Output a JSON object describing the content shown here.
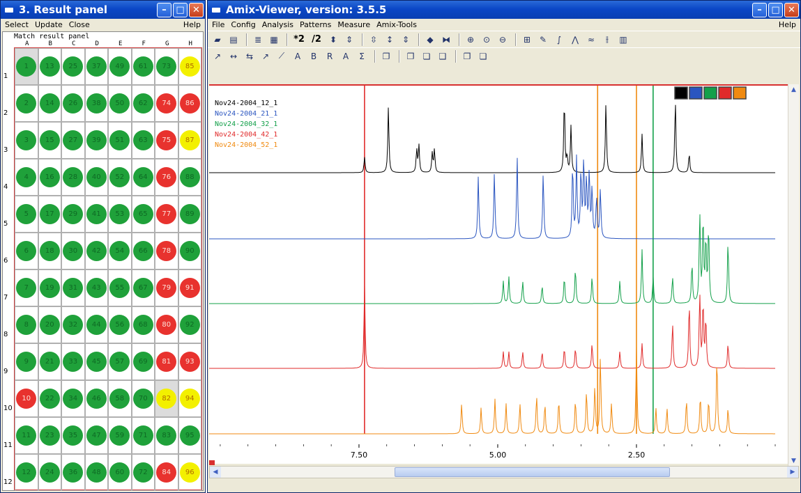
{
  "result_window": {
    "title": "3. Result panel",
    "menu": [
      "Select",
      "Update",
      "Close"
    ],
    "help": "Help",
    "caption": "Match result panel",
    "columns": [
      "A",
      "B",
      "C",
      "D",
      "E",
      "F",
      "G",
      "H"
    ],
    "rows": [
      "1",
      "2",
      "3",
      "4",
      "5",
      "6",
      "7",
      "8",
      "9",
      "10",
      "11",
      "12"
    ],
    "cells": [
      [
        {
          "n": "1",
          "c": "green",
          "sel": true
        },
        {
          "n": "13",
          "c": "green"
        },
        {
          "n": "25",
          "c": "green"
        },
        {
          "n": "37",
          "c": "green"
        },
        {
          "n": "49",
          "c": "green"
        },
        {
          "n": "61",
          "c": "green"
        },
        {
          "n": "73",
          "c": "green"
        },
        {
          "n": "85",
          "c": "yellow"
        }
      ],
      [
        {
          "n": "2",
          "c": "green"
        },
        {
          "n": "14",
          "c": "green"
        },
        {
          "n": "26",
          "c": "green"
        },
        {
          "n": "38",
          "c": "green"
        },
        {
          "n": "50",
          "c": "green"
        },
        {
          "n": "62",
          "c": "green"
        },
        {
          "n": "74",
          "c": "red"
        },
        {
          "n": "86",
          "c": "red"
        }
      ],
      [
        {
          "n": "3",
          "c": "green"
        },
        {
          "n": "15",
          "c": "green"
        },
        {
          "n": "27",
          "c": "green"
        },
        {
          "n": "39",
          "c": "green"
        },
        {
          "n": "51",
          "c": "green"
        },
        {
          "n": "63",
          "c": "green"
        },
        {
          "n": "75",
          "c": "red"
        },
        {
          "n": "87",
          "c": "yellow"
        }
      ],
      [
        {
          "n": "4",
          "c": "green"
        },
        {
          "n": "16",
          "c": "green"
        },
        {
          "n": "28",
          "c": "green"
        },
        {
          "n": "40",
          "c": "green"
        },
        {
          "n": "52",
          "c": "green"
        },
        {
          "n": "64",
          "c": "green"
        },
        {
          "n": "76",
          "c": "red"
        },
        {
          "n": "88",
          "c": "green"
        }
      ],
      [
        {
          "n": "5",
          "c": "green"
        },
        {
          "n": "17",
          "c": "green"
        },
        {
          "n": "29",
          "c": "green"
        },
        {
          "n": "41",
          "c": "green"
        },
        {
          "n": "53",
          "c": "green"
        },
        {
          "n": "65",
          "c": "green"
        },
        {
          "n": "77",
          "c": "red"
        },
        {
          "n": "89",
          "c": "green"
        }
      ],
      [
        {
          "n": "6",
          "c": "green"
        },
        {
          "n": "18",
          "c": "green"
        },
        {
          "n": "30",
          "c": "green"
        },
        {
          "n": "42",
          "c": "green"
        },
        {
          "n": "54",
          "c": "green"
        },
        {
          "n": "66",
          "c": "green"
        },
        {
          "n": "78",
          "c": "red"
        },
        {
          "n": "90",
          "c": "green"
        }
      ],
      [
        {
          "n": "7",
          "c": "green"
        },
        {
          "n": "19",
          "c": "green"
        },
        {
          "n": "31",
          "c": "green"
        },
        {
          "n": "43",
          "c": "green"
        },
        {
          "n": "55",
          "c": "green"
        },
        {
          "n": "67",
          "c": "green"
        },
        {
          "n": "79",
          "c": "red"
        },
        {
          "n": "91",
          "c": "red"
        }
      ],
      [
        {
          "n": "8",
          "c": "green"
        },
        {
          "n": "20",
          "c": "green"
        },
        {
          "n": "32",
          "c": "green"
        },
        {
          "n": "44",
          "c": "green"
        },
        {
          "n": "56",
          "c": "green"
        },
        {
          "n": "68",
          "c": "green"
        },
        {
          "n": "80",
          "c": "red"
        },
        {
          "n": "92",
          "c": "green"
        }
      ],
      [
        {
          "n": "9",
          "c": "green"
        },
        {
          "n": "21",
          "c": "green"
        },
        {
          "n": "33",
          "c": "green"
        },
        {
          "n": "45",
          "c": "green"
        },
        {
          "n": "57",
          "c": "green"
        },
        {
          "n": "69",
          "c": "green"
        },
        {
          "n": "81",
          "c": "red"
        },
        {
          "n": "93",
          "c": "red"
        }
      ],
      [
        {
          "n": "10",
          "c": "red"
        },
        {
          "n": "22",
          "c": "green"
        },
        {
          "n": "34",
          "c": "green"
        },
        {
          "n": "46",
          "c": "green"
        },
        {
          "n": "58",
          "c": "green"
        },
        {
          "n": "70",
          "c": "green"
        },
        {
          "n": "82",
          "c": "yellow",
          "sel": true
        },
        {
          "n": "94",
          "c": "yellow"
        }
      ],
      [
        {
          "n": "11",
          "c": "green"
        },
        {
          "n": "23",
          "c": "green"
        },
        {
          "n": "35",
          "c": "green"
        },
        {
          "n": "47",
          "c": "green"
        },
        {
          "n": "59",
          "c": "green"
        },
        {
          "n": "71",
          "c": "green"
        },
        {
          "n": "83",
          "c": "green"
        },
        {
          "n": "95",
          "c": "green"
        }
      ],
      [
        {
          "n": "12",
          "c": "green"
        },
        {
          "n": "24",
          "c": "green"
        },
        {
          "n": "36",
          "c": "green"
        },
        {
          "n": "48",
          "c": "green"
        },
        {
          "n": "60",
          "c": "green"
        },
        {
          "n": "72",
          "c": "green"
        },
        {
          "n": "84",
          "c": "red"
        },
        {
          "n": "96",
          "c": "yellow"
        }
      ]
    ],
    "dot_colors": {
      "green": "#1fa13a",
      "red": "#e8322e",
      "yellow": "#f3f000"
    }
  },
  "viewer_window": {
    "title": "Amix-Viewer, version: 3.5.5",
    "menu": [
      "File",
      "Config",
      "Analysis",
      "Patterns",
      "Measure",
      "Amix-Tools"
    ],
    "help": "Help",
    "toolbar1": [
      {
        "name": "open-folder-icon",
        "glyph": "▰"
      },
      {
        "name": "print-icon",
        "glyph": "▤"
      },
      {
        "sep": true
      },
      {
        "name": "stack-spectra-icon",
        "glyph": "≣"
      },
      {
        "name": "table-icon",
        "glyph": "▦"
      },
      {
        "sep": true
      },
      {
        "name": "multiply-two-button",
        "text": "*2"
      },
      {
        "name": "divide-two-button",
        "text": "/2"
      },
      {
        "name": "scale-up-down-icon",
        "glyph": "⬍"
      },
      {
        "name": "scale-fit-icon",
        "glyph": "⇕"
      },
      {
        "sep": true
      },
      {
        "name": "vertical-zoom-icon",
        "glyph": "⇳"
      },
      {
        "name": "vertical-shift-icon",
        "glyph": "↕"
      },
      {
        "name": "vertical-expand-icon",
        "glyph": "⇕"
      },
      {
        "sep": true
      },
      {
        "name": "horizontal-shift-icon",
        "glyph": "◆"
      },
      {
        "name": "horizontal-fit-icon",
        "glyph": "⧓"
      },
      {
        "sep": true
      },
      {
        "name": "zoom-in-icon",
        "glyph": "⊕"
      },
      {
        "name": "zoom-reset-icon",
        "glyph": "⊙"
      },
      {
        "name": "zoom-out-icon",
        "glyph": "⊖"
      },
      {
        "sep": true
      },
      {
        "name": "zoom-region-icon",
        "glyph": "⊞"
      },
      {
        "name": "peak-pick-icon",
        "glyph": "✎"
      },
      {
        "name": "integrate-icon",
        "glyph": "∫"
      },
      {
        "name": "multiplet-icon",
        "glyph": "⋀"
      },
      {
        "name": "baseline-icon",
        "glyph": "≈"
      },
      {
        "name": "split-icon",
        "glyph": "⫲"
      },
      {
        "name": "bucket-icon",
        "glyph": "▥"
      }
    ],
    "toolbar2": [
      {
        "name": "cursor-tool-icon",
        "glyph": "↗"
      },
      {
        "name": "distance-tool-icon",
        "glyph": "↔"
      },
      {
        "name": "double-arrow-tool-icon",
        "glyph": "⇆"
      },
      {
        "name": "draw-tool-icon",
        "glyph": "↗"
      },
      {
        "name": "line-tool-icon",
        "glyph": "⟋"
      },
      {
        "name": "annotate-h-icon",
        "glyph": "A"
      },
      {
        "name": "molecule-b-icon",
        "glyph": "B"
      },
      {
        "name": "molecule-r-icon",
        "glyph": "R"
      },
      {
        "name": "molecule-a-icon",
        "glyph": "A"
      },
      {
        "name": "sum-icon",
        "glyph": "Σ"
      },
      {
        "sep": true
      },
      {
        "name": "window-icon",
        "glyph": "❐"
      },
      {
        "sep": true
      },
      {
        "name": "cascade-icon",
        "glyph": "❐"
      },
      {
        "name": "tile-icon",
        "glyph": "❏"
      },
      {
        "name": "arrange-icon",
        "glyph": "❑"
      },
      {
        "sep": true
      },
      {
        "name": "export-icon",
        "glyph": "❐"
      },
      {
        "name": "import-icon",
        "glyph": "❏"
      }
    ],
    "color_swatches": [
      "#000000",
      "#2a55c0",
      "#13a04a",
      "#e02a2a",
      "#f08a10"
    ]
  },
  "chart_data": {
    "type": "line",
    "title": "",
    "xlabel": "",
    "ylabel": "",
    "x_reversed": true,
    "xlim": [
      10.2,
      0.0
    ],
    "x_ticks": [
      7.5,
      5.0,
      2.5
    ],
    "x_tick_labels": [
      "7.50",
      "5.00",
      "2.50"
    ],
    "legend_position": "top-left",
    "cursor_lines": [
      {
        "x": 7.4,
        "color": "#e02a2a"
      },
      {
        "x": 3.2,
        "color": "#f08a10"
      },
      {
        "x": 2.5,
        "color": "#f08a10"
      },
      {
        "x": 2.2,
        "color": "#13a04a"
      }
    ],
    "series": [
      {
        "name": "Nov24-2004_12_1",
        "color": "#000000",
        "peaks": [
          [
            7.4,
            0.2
          ],
          [
            6.97,
            0.85
          ],
          [
            6.46,
            0.3
          ],
          [
            6.42,
            0.35
          ],
          [
            6.18,
            0.25
          ],
          [
            6.14,
            0.3
          ],
          [
            3.8,
            0.95
          ],
          [
            3.75,
            0.2
          ],
          [
            3.68,
            0.6
          ],
          [
            3.05,
            0.9
          ],
          [
            2.4,
            0.5
          ],
          [
            1.8,
            0.95
          ],
          [
            1.55,
            0.25
          ]
        ]
      },
      {
        "name": "Nov24-2004_21_1",
        "color": "#2a55c0",
        "peaks": [
          [
            5.35,
            0.75
          ],
          [
            5.06,
            0.8
          ],
          [
            4.65,
            1.0
          ],
          [
            4.18,
            0.8
          ],
          [
            3.65,
            0.9
          ],
          [
            3.58,
            0.95
          ],
          [
            3.5,
            0.8
          ],
          [
            3.45,
            0.95
          ],
          [
            3.4,
            0.7
          ],
          [
            3.35,
            0.8
          ],
          [
            3.3,
            0.6
          ],
          [
            3.22,
            0.5
          ],
          [
            3.15,
            0.6
          ]
        ]
      },
      {
        "name": "Nov24-2004_32_1",
        "color": "#13a04a",
        "peaks": [
          [
            4.9,
            0.25
          ],
          [
            4.8,
            0.3
          ],
          [
            4.55,
            0.25
          ],
          [
            4.2,
            0.2
          ],
          [
            3.8,
            0.3
          ],
          [
            3.6,
            0.4
          ],
          [
            3.3,
            0.3
          ],
          [
            2.8,
            0.25
          ],
          [
            2.4,
            0.6
          ],
          [
            2.2,
            0.3
          ],
          [
            1.85,
            0.3
          ],
          [
            1.5,
            0.45
          ],
          [
            1.36,
            1.0
          ],
          [
            1.3,
            0.95
          ],
          [
            1.25,
            0.7
          ],
          [
            1.2,
            0.85
          ],
          [
            0.85,
            0.7
          ]
        ]
      },
      {
        "name": "Nov24-2004_42_1",
        "color": "#e02a2a",
        "peaks": [
          [
            7.4,
            1.0
          ],
          [
            4.9,
            0.2
          ],
          [
            4.8,
            0.2
          ],
          [
            4.55,
            0.2
          ],
          [
            4.2,
            0.2
          ],
          [
            3.8,
            0.25
          ],
          [
            3.6,
            0.25
          ],
          [
            3.3,
            0.3
          ],
          [
            2.8,
            0.2
          ],
          [
            2.4,
            0.3
          ],
          [
            1.85,
            0.55
          ],
          [
            1.55,
            0.8
          ],
          [
            1.36,
            0.9
          ],
          [
            1.3,
            0.8
          ],
          [
            1.25,
            0.6
          ],
          [
            0.85,
            0.3
          ]
        ]
      },
      {
        "name": "Nov24-2004_52_1",
        "color": "#f08a10",
        "peaks": [
          [
            5.65,
            0.35
          ],
          [
            5.3,
            0.3
          ],
          [
            5.05,
            0.4
          ],
          [
            4.85,
            0.35
          ],
          [
            4.6,
            0.35
          ],
          [
            4.3,
            0.45
          ],
          [
            4.15,
            0.35
          ],
          [
            3.9,
            0.4
          ],
          [
            3.6,
            0.4
          ],
          [
            3.4,
            0.5
          ],
          [
            3.25,
            0.55
          ],
          [
            3.15,
            0.9
          ],
          [
            2.95,
            0.35
          ],
          [
            2.5,
            1.0
          ],
          [
            2.15,
            0.3
          ],
          [
            1.95,
            0.3
          ],
          [
            1.6,
            0.4
          ],
          [
            1.35,
            0.45
          ],
          [
            1.2,
            0.4
          ],
          [
            1.05,
            0.9
          ],
          [
            0.85,
            0.3
          ]
        ]
      }
    ]
  }
}
